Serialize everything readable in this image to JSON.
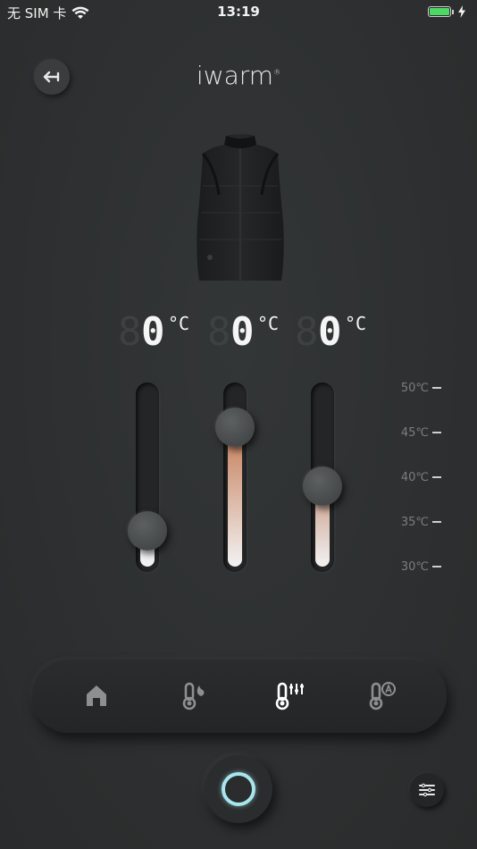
{
  "status_bar": {
    "carrier": "无 SIM 卡",
    "time": "13:19",
    "battery_color": "#4cd964"
  },
  "header": {
    "logo": "iwarm",
    "back_icon": "back-arrow-icon"
  },
  "zones": [
    {
      "ghost": "8",
      "value": "0",
      "unit": "°C",
      "level": 0.2,
      "fill_top": "#f2f2f2",
      "fill_bottom": "#f2f2f2"
    },
    {
      "ghost": "8",
      "value": "0",
      "unit": "°C",
      "level": 0.78,
      "fill_top": "#c47a55",
      "fill_bottom": "#f2f2f2"
    },
    {
      "ghost": "8",
      "value": "0",
      "unit": "°C",
      "level": 0.45,
      "fill_top": "#c99a84",
      "fill_bottom": "#f2f2f2"
    }
  ],
  "scale": [
    "50℃",
    "45℃",
    "40℃",
    "35℃",
    "30℃"
  ],
  "nav": {
    "items": [
      {
        "icon": "home-icon"
      },
      {
        "icon": "thermometer-flame-icon"
      },
      {
        "icon": "thermometer-adjust-icon"
      },
      {
        "icon": "thermometer-auto-icon"
      }
    ],
    "active_index": 2
  },
  "controls": {
    "power_icon": "power-ring-icon",
    "power_color": "#a8e6ee",
    "menu_icon": "menu-list-icon"
  }
}
